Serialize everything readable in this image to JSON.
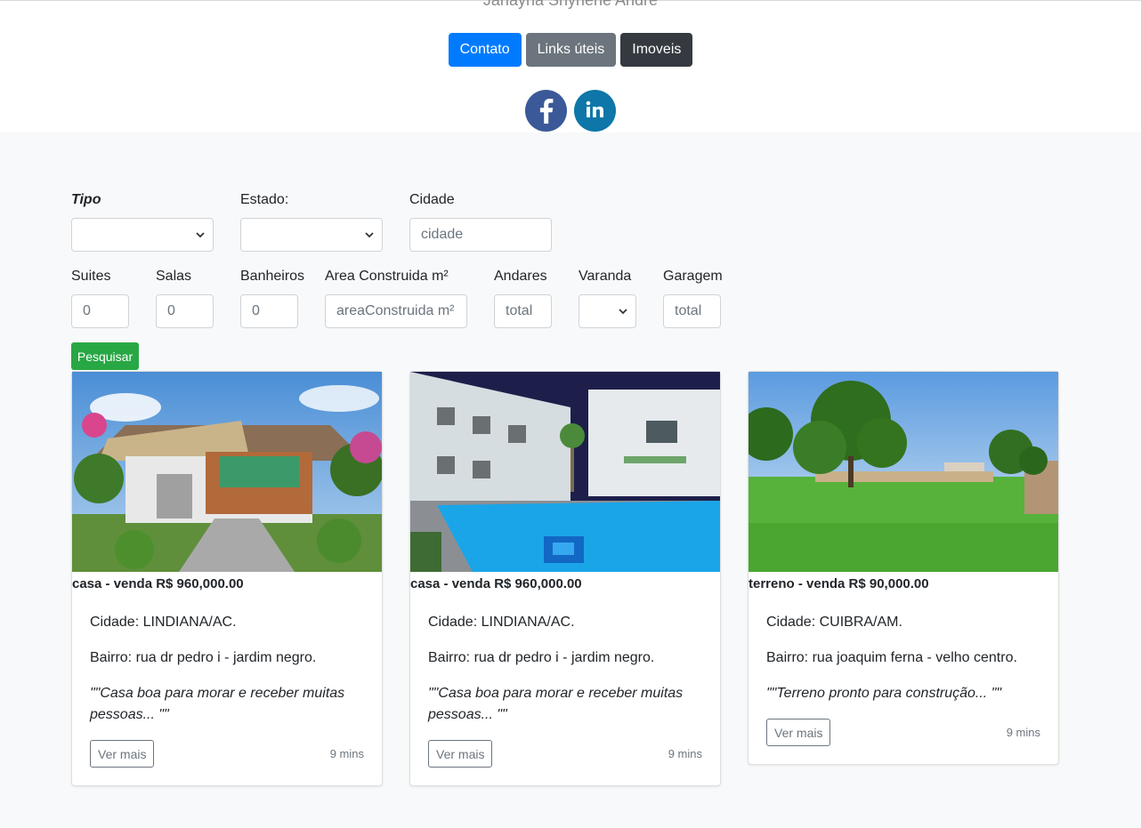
{
  "header": {
    "author": "Janayna Shyrlene Andre",
    "nav": [
      "Contato",
      "Links úteis",
      "Imoveis"
    ],
    "social_icons": [
      "facebook-icon",
      "linkedin-icon"
    ]
  },
  "filters": {
    "tipo_label": "Tipo",
    "estado_label": "Estado:",
    "cidade_label": "Cidade",
    "cidade_placeholder": "cidade",
    "suites_label": "Suites",
    "suites_value": "0",
    "salas_label": "Salas",
    "salas_value": "0",
    "banheiros_label": "Banheiros",
    "banheiros_value": "0",
    "area_label": "Area Construida m²",
    "area_placeholder": "areaConstruida m²",
    "andares_label": "Andares",
    "andares_placeholder": "total",
    "varanda_label": "Varanda",
    "garagem_label": "Garagem",
    "garagem_placeholder": "total",
    "search_button": "Pesquisar"
  },
  "listings": [
    {
      "title": "casa - venda R$ 960,000.00",
      "city": "Cidade: LINDIANA/AC.",
      "bairro": "Bairro: rua dr pedro i - jardim negro.",
      "desc": "\"\"Casa boa para morar e receber muitas pessoas... \"\"",
      "button": "Ver mais",
      "time": "9 mins"
    },
    {
      "title": "casa - venda R$ 960,000.00",
      "city": "Cidade: LINDIANA/AC.",
      "bairro": "Bairro: rua dr pedro i - jardim negro.",
      "desc": "\"\"Casa boa para morar e receber muitas pessoas... \"\"",
      "button": "Ver mais",
      "time": "9 mins"
    },
    {
      "title": "terreno - venda R$ 90,000.00",
      "city": "Cidade: CUIBRA/AM.",
      "bairro": "Bairro: rua joaquim ferna - velho centro.",
      "desc": "\"\"Terreno pronto para construção... \"\"",
      "button": "Ver mais",
      "time": "9 mins"
    }
  ],
  "colors": {
    "primary": "#007bff",
    "secondary": "#6c757d",
    "dark": "#343a40",
    "success": "#28a745",
    "facebook": "#3b5998",
    "linkedin": "#0e76a8"
  }
}
